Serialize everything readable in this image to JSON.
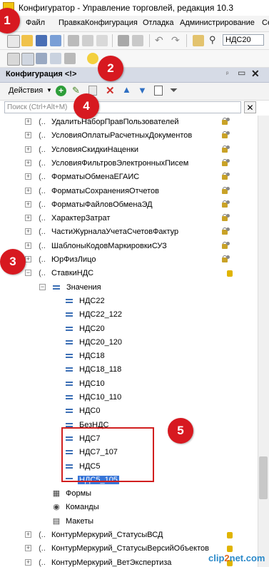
{
  "window": {
    "title": "Конфигуратор - Управление торговлей, редакция 10.3"
  },
  "menubar": {
    "items": [
      "Файл",
      "Правка",
      "Конфигурация",
      "Отладка",
      "Администрирование",
      "Се"
    ]
  },
  "toolbar": {
    "search_value": "НДС20"
  },
  "config_panel": {
    "title": "Конфигурация <!>",
    "actions_label": "Действия",
    "filter_placeholder": "Поиск (Ctrl+Alt+M)"
  },
  "tree": {
    "items": [
      "УдалитьНаборПравПользователей",
      "УсловияОплатыРасчетныхДокументов",
      "УсловияСкидкиНаценки",
      "УсловияФильтровЭлектронныхПисем",
      "ФорматыОбменаЕГАИС",
      "ФорматыСохраненияОтчетов",
      "ФорматыФайловОбменаЭД",
      "ХарактерЗатрат",
      "ЧастиЖурналаУчетаСчетовФактур",
      "ШаблоныКодовМаркировкиСУЗ",
      "ЮрФизЛицо",
      "СтавкиНДС"
    ],
    "values_group": "Значения",
    "values": [
      "НДС22",
      "НДС22_122",
      "НДС20",
      "НДС20_120",
      "НДС18",
      "НДС18_118",
      "НДС10",
      "НДС10_110",
      "НДС0",
      "БезНДС",
      "НДС7",
      "НДС7_107",
      "НДС5",
      "НДС5_105"
    ],
    "subitems": [
      "Формы",
      "Команды",
      "Макеты"
    ],
    "after_items": [
      "КонтурМеркурий_СтатусыВСД",
      "КонтурМеркурий_СтатусыВерсийОбъектов",
      "КонтурМеркурий_ВетЭкспертиза"
    ]
  },
  "markers": [
    "1",
    "2",
    "3",
    "4",
    "5"
  ],
  "watermark": {
    "text_a": "clip",
    "text_b": "2",
    "text_c": "net.com"
  },
  "colors": {
    "marker_red": "#d71920",
    "selection_blue": "#3875d7",
    "highlight_box": "#d11f1f"
  }
}
